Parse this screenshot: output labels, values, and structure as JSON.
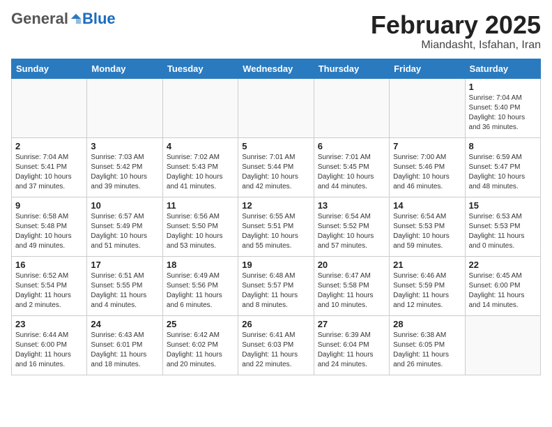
{
  "header": {
    "logo_general": "General",
    "logo_blue": "Blue",
    "month_title": "February 2025",
    "subtitle": "Miandasht, Isfahan, Iran"
  },
  "days_of_week": [
    "Sunday",
    "Monday",
    "Tuesday",
    "Wednesday",
    "Thursday",
    "Friday",
    "Saturday"
  ],
  "weeks": [
    [
      {
        "day": "",
        "info": ""
      },
      {
        "day": "",
        "info": ""
      },
      {
        "day": "",
        "info": ""
      },
      {
        "day": "",
        "info": ""
      },
      {
        "day": "",
        "info": ""
      },
      {
        "day": "",
        "info": ""
      },
      {
        "day": "1",
        "info": "Sunrise: 7:04 AM\nSunset: 5:40 PM\nDaylight: 10 hours and 36 minutes."
      }
    ],
    [
      {
        "day": "2",
        "info": "Sunrise: 7:04 AM\nSunset: 5:41 PM\nDaylight: 10 hours and 37 minutes."
      },
      {
        "day": "3",
        "info": "Sunrise: 7:03 AM\nSunset: 5:42 PM\nDaylight: 10 hours and 39 minutes."
      },
      {
        "day": "4",
        "info": "Sunrise: 7:02 AM\nSunset: 5:43 PM\nDaylight: 10 hours and 41 minutes."
      },
      {
        "day": "5",
        "info": "Sunrise: 7:01 AM\nSunset: 5:44 PM\nDaylight: 10 hours and 42 minutes."
      },
      {
        "day": "6",
        "info": "Sunrise: 7:01 AM\nSunset: 5:45 PM\nDaylight: 10 hours and 44 minutes."
      },
      {
        "day": "7",
        "info": "Sunrise: 7:00 AM\nSunset: 5:46 PM\nDaylight: 10 hours and 46 minutes."
      },
      {
        "day": "8",
        "info": "Sunrise: 6:59 AM\nSunset: 5:47 PM\nDaylight: 10 hours and 48 minutes."
      }
    ],
    [
      {
        "day": "9",
        "info": "Sunrise: 6:58 AM\nSunset: 5:48 PM\nDaylight: 10 hours and 49 minutes."
      },
      {
        "day": "10",
        "info": "Sunrise: 6:57 AM\nSunset: 5:49 PM\nDaylight: 10 hours and 51 minutes."
      },
      {
        "day": "11",
        "info": "Sunrise: 6:56 AM\nSunset: 5:50 PM\nDaylight: 10 hours and 53 minutes."
      },
      {
        "day": "12",
        "info": "Sunrise: 6:55 AM\nSunset: 5:51 PM\nDaylight: 10 hours and 55 minutes."
      },
      {
        "day": "13",
        "info": "Sunrise: 6:54 AM\nSunset: 5:52 PM\nDaylight: 10 hours and 57 minutes."
      },
      {
        "day": "14",
        "info": "Sunrise: 6:54 AM\nSunset: 5:53 PM\nDaylight: 10 hours and 59 minutes."
      },
      {
        "day": "15",
        "info": "Sunrise: 6:53 AM\nSunset: 5:53 PM\nDaylight: 11 hours and 0 minutes."
      }
    ],
    [
      {
        "day": "16",
        "info": "Sunrise: 6:52 AM\nSunset: 5:54 PM\nDaylight: 11 hours and 2 minutes."
      },
      {
        "day": "17",
        "info": "Sunrise: 6:51 AM\nSunset: 5:55 PM\nDaylight: 11 hours and 4 minutes."
      },
      {
        "day": "18",
        "info": "Sunrise: 6:49 AM\nSunset: 5:56 PM\nDaylight: 11 hours and 6 minutes."
      },
      {
        "day": "19",
        "info": "Sunrise: 6:48 AM\nSunset: 5:57 PM\nDaylight: 11 hours and 8 minutes."
      },
      {
        "day": "20",
        "info": "Sunrise: 6:47 AM\nSunset: 5:58 PM\nDaylight: 11 hours and 10 minutes."
      },
      {
        "day": "21",
        "info": "Sunrise: 6:46 AM\nSunset: 5:59 PM\nDaylight: 11 hours and 12 minutes."
      },
      {
        "day": "22",
        "info": "Sunrise: 6:45 AM\nSunset: 6:00 PM\nDaylight: 11 hours and 14 minutes."
      }
    ],
    [
      {
        "day": "23",
        "info": "Sunrise: 6:44 AM\nSunset: 6:00 PM\nDaylight: 11 hours and 16 minutes."
      },
      {
        "day": "24",
        "info": "Sunrise: 6:43 AM\nSunset: 6:01 PM\nDaylight: 11 hours and 18 minutes."
      },
      {
        "day": "25",
        "info": "Sunrise: 6:42 AM\nSunset: 6:02 PM\nDaylight: 11 hours and 20 minutes."
      },
      {
        "day": "26",
        "info": "Sunrise: 6:41 AM\nSunset: 6:03 PM\nDaylight: 11 hours and 22 minutes."
      },
      {
        "day": "27",
        "info": "Sunrise: 6:39 AM\nSunset: 6:04 PM\nDaylight: 11 hours and 24 minutes."
      },
      {
        "day": "28",
        "info": "Sunrise: 6:38 AM\nSunset: 6:05 PM\nDaylight: 11 hours and 26 minutes."
      },
      {
        "day": "",
        "info": ""
      }
    ]
  ]
}
